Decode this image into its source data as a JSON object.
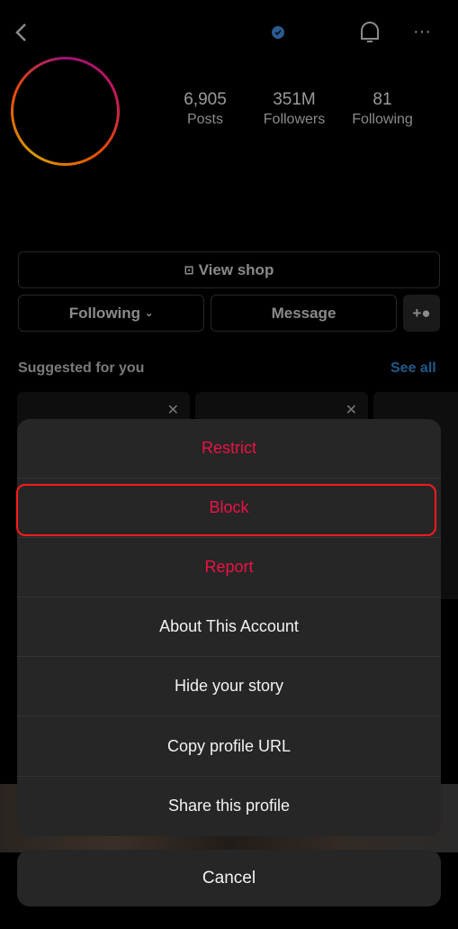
{
  "header": {
    "back_icon": "chevron-left-icon",
    "verified_icon": "verified-badge-icon",
    "bell_icon": "bell-icon",
    "more_icon": "more-horizontal-icon",
    "verified_color": "#3897f0"
  },
  "profile": {
    "stats": [
      {
        "value": "6,905",
        "label": "Posts"
      },
      {
        "value": "351M",
        "label": "Followers"
      },
      {
        "value": "81",
        "label": "Following"
      }
    ]
  },
  "actions": {
    "view_shop": "View shop",
    "following": "Following",
    "message": "Message",
    "add_user_icon": "add-person-icon"
  },
  "suggested": {
    "title": "Suggested for you",
    "see_all": "See all"
  },
  "sheet": {
    "items": [
      {
        "label": "Restrict",
        "destructive": true
      },
      {
        "label": "Block",
        "destructive": true,
        "highlighted": true
      },
      {
        "label": "Report",
        "destructive": true
      },
      {
        "label": "About This Account",
        "destructive": false
      },
      {
        "label": "Hide your story",
        "destructive": false
      },
      {
        "label": "Copy profile URL",
        "destructive": false
      },
      {
        "label": "Share this profile",
        "destructive": false
      }
    ],
    "cancel": "Cancel"
  },
  "colors": {
    "destructive": "#ed1245",
    "highlight": "#ff1a1a",
    "sheet_bg": "#262626"
  }
}
